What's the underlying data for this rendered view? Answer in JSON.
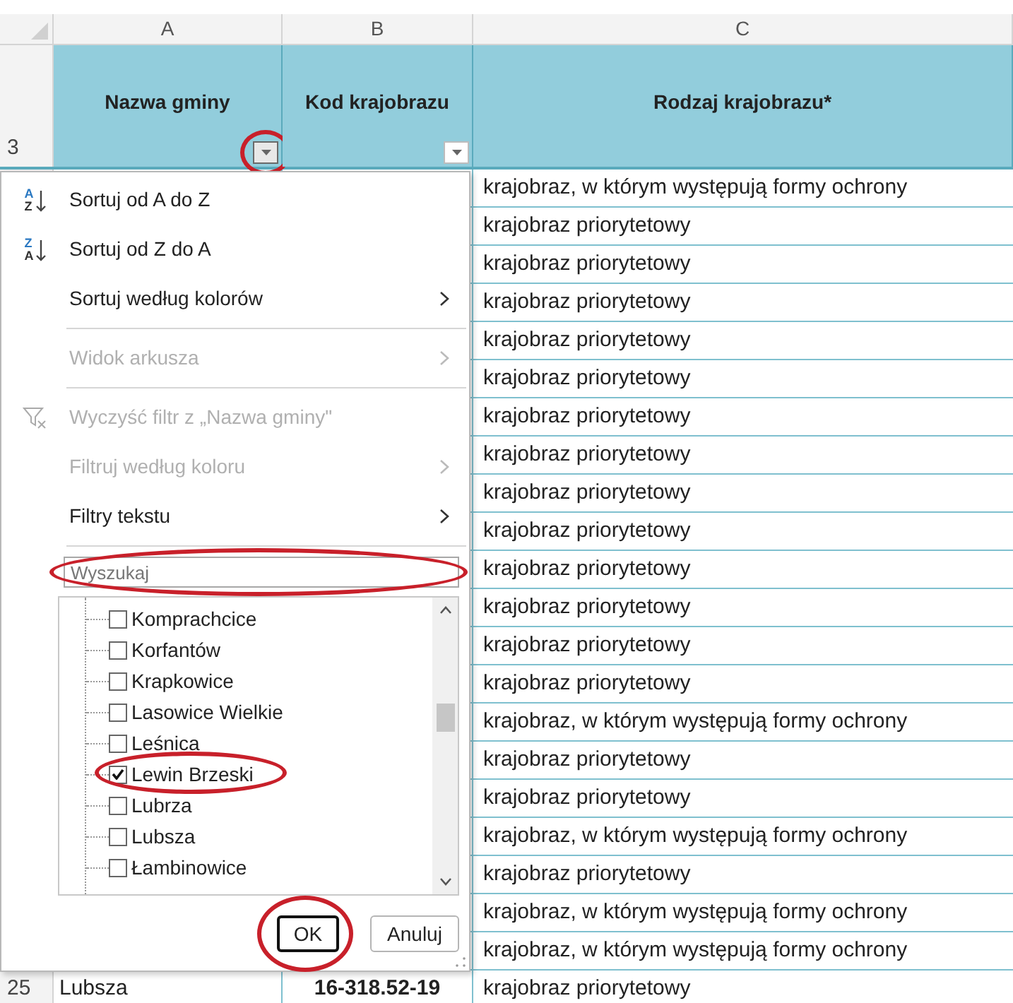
{
  "column_letters": [
    "A",
    "B",
    "C"
  ],
  "header_row": {
    "number": "3",
    "cells": [
      {
        "text": "Nazwa gminy",
        "filter_button": true,
        "pressed": true,
        "highlighted": true
      },
      {
        "text": "Kod krajobrazu",
        "filter_button": true,
        "pressed": false,
        "highlighted": false
      },
      {
        "text": "Rodzaj krajobrazu*"
      }
    ]
  },
  "column_c_cells": [
    "krajobraz, w którym występują formy ochrony",
    "krajobraz priorytetowy",
    "krajobraz priorytetowy",
    "krajobraz priorytetowy",
    "krajobraz priorytetowy",
    "krajobraz priorytetowy",
    "krajobraz priorytetowy",
    "krajobraz priorytetowy",
    "krajobraz priorytetowy",
    "krajobraz priorytetowy",
    "krajobraz priorytetowy",
    "krajobraz priorytetowy",
    "krajobraz priorytetowy",
    "krajobraz priorytetowy",
    "krajobraz, w którym występują formy ochrony",
    "krajobraz priorytetowy",
    "krajobraz priorytetowy",
    "krajobraz, w którym występują formy ochrony",
    "krajobraz priorytetowy",
    "krajobraz, w którym występują formy ochrony",
    "krajobraz, w którym występują formy ochrony"
  ],
  "last_row": {
    "number": "25",
    "cells": [
      "Lubsza",
      "16-318.52-19",
      "krajobraz priorytetowy"
    ]
  },
  "filter_menu": {
    "items": [
      {
        "kind": "sort",
        "icon_top": "A",
        "icon_bottom": "Z",
        "label": "Sortuj od A do Z",
        "disabled": false,
        "submenu": false
      },
      {
        "kind": "sort",
        "icon_top": "Z",
        "icon_bottom": "A",
        "label": "Sortuj od Z do A",
        "disabled": false,
        "submenu": false
      },
      {
        "kind": "plain",
        "label": "Sortuj według kolorów",
        "disabled": false,
        "submenu": true
      },
      {
        "kind": "separator"
      },
      {
        "kind": "plain",
        "label": "Widok arkusza",
        "disabled": true,
        "submenu": true
      },
      {
        "kind": "separator"
      },
      {
        "kind": "clear_filter",
        "label": "Wyczyść filtr z „Nazwa gminy\"",
        "disabled": true,
        "submenu": false
      },
      {
        "kind": "plain",
        "label": "Filtruj według koloru",
        "disabled": true,
        "submenu": true
      },
      {
        "kind": "plain",
        "label": "Filtry tekstu",
        "disabled": false,
        "submenu": true
      },
      {
        "kind": "separator"
      }
    ],
    "search": {
      "placeholder": "Wyszukaj",
      "highlighted": true
    },
    "list": [
      {
        "label": "Komprachcice",
        "checked": false,
        "highlighted": false
      },
      {
        "label": "Korfantów",
        "checked": false,
        "highlighted": false
      },
      {
        "label": "Krapkowice",
        "checked": false,
        "highlighted": false
      },
      {
        "label": "Lasowice Wielkie",
        "checked": false,
        "highlighted": false
      },
      {
        "label": "Leśnica",
        "checked": false,
        "highlighted": false
      },
      {
        "label": "Lewin Brzeski",
        "checked": true,
        "highlighted": true
      },
      {
        "label": "Lubrza",
        "checked": false,
        "highlighted": false
      },
      {
        "label": "Lubsza",
        "checked": false,
        "highlighted": false
      },
      {
        "label": "Łambinowice",
        "checked": false,
        "highlighted": false
      }
    ],
    "buttons": [
      {
        "label": "OK",
        "default": true,
        "highlighted": true
      },
      {
        "label": "Anuluj",
        "default": false,
        "highlighted": false
      }
    ]
  }
}
